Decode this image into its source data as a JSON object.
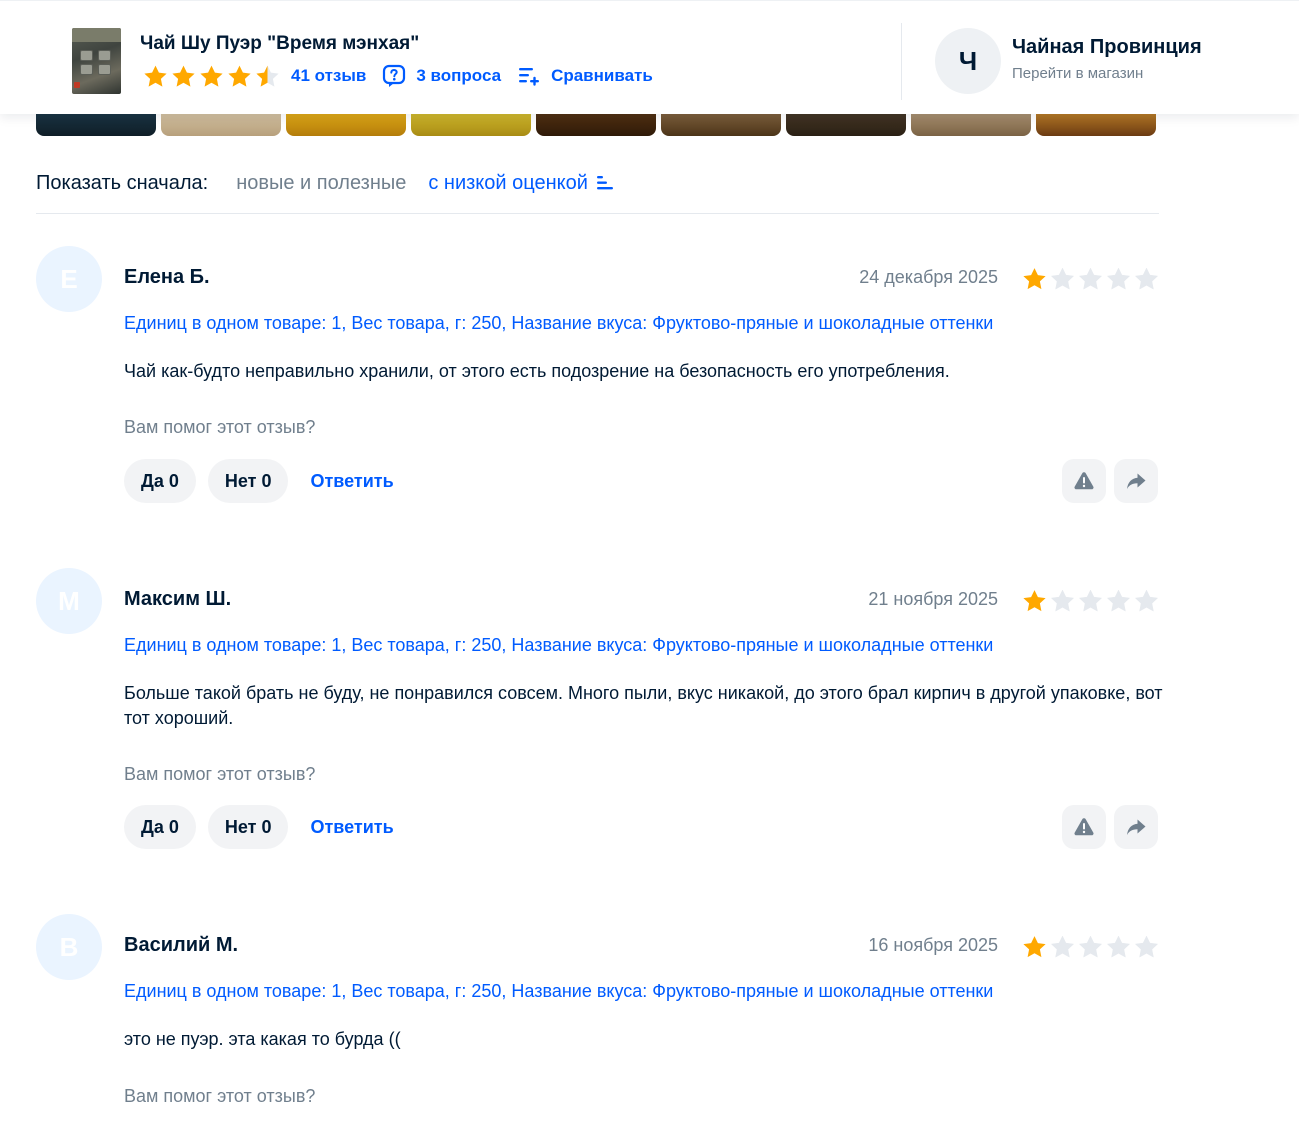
{
  "header": {
    "product_title": "Чай Шу Пуэр \"Время мэнхая\"",
    "rating": 4.5,
    "reviews_link": "41 отзыв",
    "questions_link": "3 вопроса",
    "compare_link": "Сравнивать",
    "shop": {
      "initial": "Ч",
      "name": "Чайная Провинция",
      "subtitle": "Перейти в магазин"
    }
  },
  "sort": {
    "label": "Показать сначала:",
    "options": [
      "новые и полезные",
      "с низкой оценкой"
    ],
    "active": "с низкой оценкой"
  },
  "reviews": [
    {
      "initial": "Е",
      "author": "Елена Б.",
      "date": "24 декабря 2025",
      "rating": 1,
      "variant": "Единиц в одном товаре: 1, Вес товара, г: 250, Название вкуса: Фруктово-пряные и шоколадные оттенки",
      "text": "Чай как-будто неправильно хранили, от этого есть подозрение на безопасность его употребления.",
      "helpful_prompt": "Вам помог этот отзыв?",
      "yes_label": "Да 0",
      "no_label": "Нет 0",
      "reply_label": "Ответить"
    },
    {
      "initial": "М",
      "author": "Максим Ш.",
      "date": "21 ноября 2025",
      "rating": 1,
      "variant": "Единиц в одном товаре: 1, Вес товара, г: 250, Название вкуса: Фруктово-пряные и шоколадные оттенки",
      "text": "Больше такой брать не буду, не понравился совсем. Много пыли, вкус никакой, до этого брал кирпич в другой упаковке, вот тот хороший.",
      "helpful_prompt": "Вам помог этот отзыв?",
      "yes_label": "Да 0",
      "no_label": "Нет 0",
      "reply_label": "Ответить"
    },
    {
      "initial": "В",
      "author": "Василий М.",
      "date": "16 ноября 2025",
      "rating": 1,
      "variant": "Единиц в одном товаре: 1, Вес товара, г: 250, Название вкуса: Фруктово-пряные и шоколадные оттенки",
      "text": "это не пуэр. эта какая то бурда ((",
      "helpful_prompt": "Вам помог этот отзыв?",
      "yes_label": "Да 0",
      "no_label": "Нет 0",
      "reply_label": "Ответить"
    }
  ],
  "colors": {
    "accent": "#005bff",
    "star_filled": "#ffa800",
    "star_empty": "#e5e9ee",
    "muted_text": "#707f8d"
  },
  "icons": {
    "questions": "question-bubble-icon",
    "compare": "compare-list-icon",
    "sort": "sort-lines-icon",
    "complain": "warning-triangle-icon",
    "share": "share-arrow-icon"
  }
}
